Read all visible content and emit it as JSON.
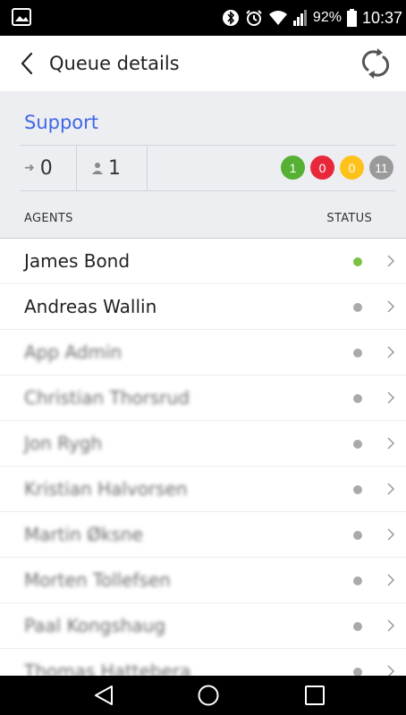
{
  "status_bar": {
    "battery": "92%",
    "time": "10:37",
    "icons": [
      "image-icon",
      "bluetooth-icon",
      "alarm-icon",
      "wifi-icon",
      "signal-icon",
      "battery-icon"
    ]
  },
  "header": {
    "title": "Queue details",
    "back_icon": "chevron-left-icon",
    "refresh_icon": "refresh-icon"
  },
  "queue": {
    "name": "Support",
    "waiting": "0",
    "agents_count": "1",
    "badges": [
      {
        "value": "1",
        "color": "#55b034"
      },
      {
        "value": "0",
        "color": "#e8283a"
      },
      {
        "value": "0",
        "color": "#ffc21a"
      },
      {
        "value": "11",
        "color": "#9a9a9a"
      }
    ]
  },
  "columns": {
    "agents": "AGENTS",
    "status": "STATUS"
  },
  "agents": [
    {
      "name": "James Bond",
      "status_color": "#7cc242",
      "blurred": false
    },
    {
      "name": "Andreas Wallin",
      "status_color": "#aaaaaa",
      "blurred": false
    },
    {
      "name": "App Admin",
      "status_color": "#aaaaaa",
      "blurred": true
    },
    {
      "name": "Christian Thorsrud",
      "status_color": "#aaaaaa",
      "blurred": true
    },
    {
      "name": "Jon Rygh",
      "status_color": "#aaaaaa",
      "blurred": true
    },
    {
      "name": "Kristian Halvorsen",
      "status_color": "#aaaaaa",
      "blurred": true
    },
    {
      "name": "Martin Øksne",
      "status_color": "#aaaaaa",
      "blurred": true
    },
    {
      "name": "Morten Tollefsen",
      "status_color": "#aaaaaa",
      "blurred": true
    },
    {
      "name": "Paal Kongshaug",
      "status_color": "#aaaaaa",
      "blurred": true
    },
    {
      "name": "Thomas Hattebera",
      "status_color": "#aaaaaa",
      "blurred": true
    }
  ],
  "colors": {
    "accent": "#3f66e6",
    "summary_bg": "#eceef1"
  }
}
